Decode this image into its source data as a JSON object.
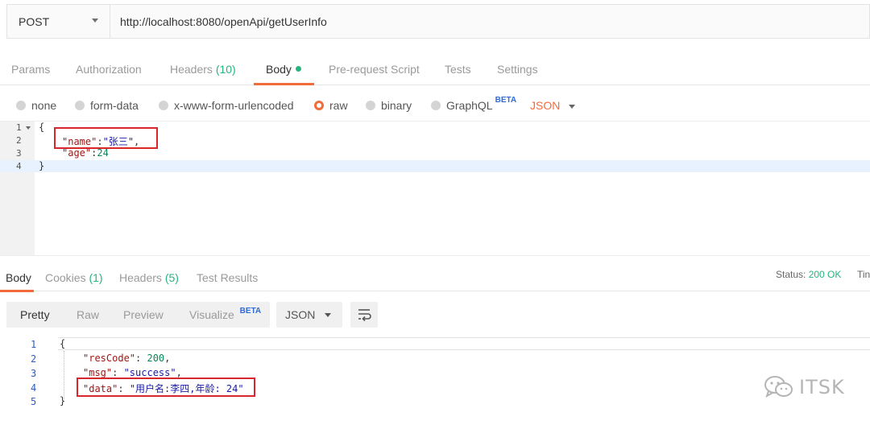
{
  "request": {
    "method": "POST",
    "url": "http://localhost:8080/openApi/getUserInfo"
  },
  "request_tabs": {
    "params": "Params",
    "authorization": "Authorization",
    "headers": "Headers",
    "headers_count": "(10)",
    "body": "Body",
    "pre_request": "Pre-request Script",
    "tests": "Tests",
    "settings": "Settings"
  },
  "body_options": {
    "none": "none",
    "form_data": "form-data",
    "urlencoded": "x-www-form-urlencoded",
    "raw": "raw",
    "binary": "binary",
    "graphql": "GraphQL",
    "beta": "BETA",
    "format": "JSON",
    "selected": "raw"
  },
  "request_editor": {
    "line_numbers": [
      "1",
      "2",
      "3",
      "4"
    ],
    "open_brace": "{",
    "name_key": "\"name\"",
    "colon": ":",
    "name_value": "\"张三\"",
    "comma": ",",
    "age_key": "\"age\"",
    "age_value": "24",
    "close_brace": "}"
  },
  "response_tabs": {
    "body": "Body",
    "cookies": "Cookies",
    "cookies_count": "(1)",
    "headers": "Headers",
    "headers_count": "(5)",
    "test_results": "Test Results",
    "status_label": "Status:",
    "status_value": "200 OK",
    "time_label_truncated": "Tin"
  },
  "response_toolbar": {
    "pretty": "Pretty",
    "raw": "Raw",
    "preview": "Preview",
    "visualize": "Visualize",
    "beta": "BETA",
    "format": "JSON"
  },
  "response_body": {
    "line_numbers": [
      "1",
      "2",
      "3",
      "4",
      "5"
    ],
    "open_brace": "{",
    "rescode_key": "\"resCode\"",
    "rescode_value": "200",
    "msg_key": "\"msg\"",
    "msg_value": "\"success\"",
    "data_key": "\"data\"",
    "data_value": "\"用户名:李四,年龄: 24\"",
    "close_brace": "}"
  },
  "watermark": {
    "text": "ITSK",
    "icon": "wechat-icon"
  },
  "colors": {
    "accent": "#f26b3a",
    "count_green": "#26b47f",
    "annotation_red": "#d8262c",
    "beta_blue": "#2f6bd6"
  }
}
